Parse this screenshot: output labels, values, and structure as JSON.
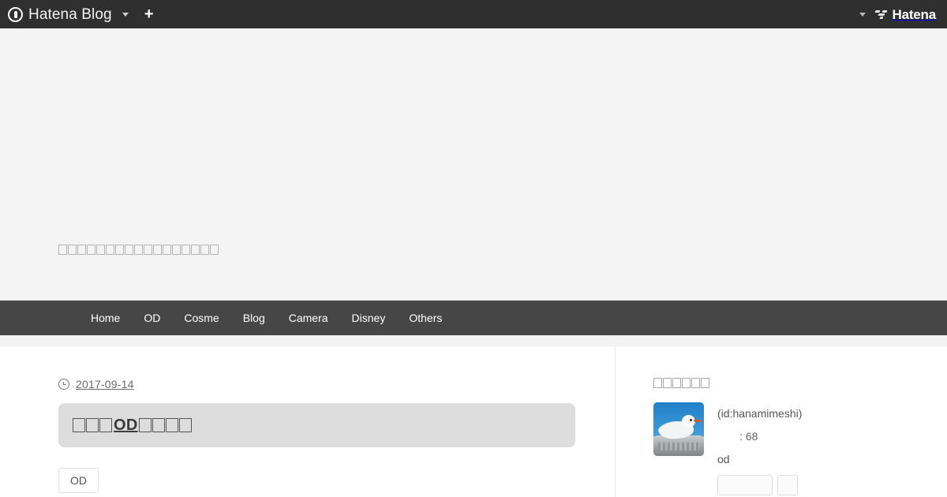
{
  "globalheader": {
    "brand_label": "Hatena Blog",
    "blog_mark_icon": "hatena-blog-logo-icon",
    "brand_caret_icon": "chevron-down-icon",
    "new_entry_icon": "plus-icon",
    "new_entry_label": "+",
    "account_caret_icon": "chevron-down-icon",
    "hatena_label": "Hatena",
    "hatena_mark_icon": "hatena-logo-icon"
  },
  "blog_header": {
    "title_tofu_count": 17,
    "title_note": "blog title rendered as missing-glyph boxes"
  },
  "nav": {
    "items": [
      {
        "label": "Home"
      },
      {
        "label": "OD"
      },
      {
        "label": "Cosme"
      },
      {
        "label": "Blog"
      },
      {
        "label": "Camera"
      },
      {
        "label": "Disney"
      },
      {
        "label": "Others"
      }
    ]
  },
  "entry": {
    "date_icon": "clock-icon",
    "date": "2017-09-14",
    "title_tofu_before": 3,
    "title_text": "OD",
    "title_tofu_after": 4,
    "tags": [
      {
        "label": "OD"
      }
    ]
  },
  "sidebar": {
    "heading_tofu_count": 6,
    "profile": {
      "avatar_icon": "seagull-avatar",
      "id_text": "(id:hanamimeshi)",
      "count_text": ": 68",
      "description": "od",
      "buttons": [
        {
          "label": ""
        },
        {
          "label": ""
        }
      ]
    }
  },
  "colors": {
    "globalheader_bg": "#2f2f2f",
    "nav_bg": "#464646",
    "hero_bg": "#f4f4f4",
    "entry_title_bg": "#dddddd",
    "page_bg": "#ffffff"
  }
}
